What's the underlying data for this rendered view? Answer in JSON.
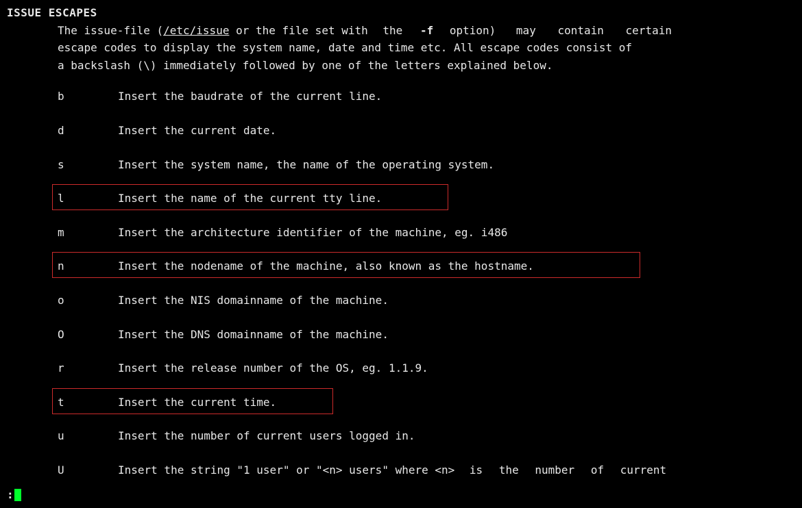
{
  "section_title": "ISSUE ESCAPES",
  "intro_pre": "The issue-file (",
  "intro_path": "/etc/issue",
  "intro_post1": " or the file set with",
  "intro_the1": "the",
  "intro_flag": "-f",
  "intro_opt": "option)",
  "intro_may": "may",
  "intro_contain": "contain",
  "intro_certain": "certain",
  "intro_line2": "escape  codes to display the system name, date and time etc. All escape codes consist of",
  "intro_line3": "a backslash (\\) immediately followed by one of the letters explained below.",
  "entries": [
    {
      "key": "b",
      "text": "Insert the baudrate of the current line."
    },
    {
      "key": "d",
      "text": "Insert the current date."
    },
    {
      "key": "s",
      "text": "Insert the system name, the name of the operating system."
    },
    {
      "key": "l",
      "text": "Insert the name of the current tty line."
    },
    {
      "key": "m",
      "text": "Insert the architecture identifier of the machine, eg. i486"
    },
    {
      "key": "n",
      "text": "Insert the nodename of the machine, also known as the hostname."
    },
    {
      "key": "o",
      "text": "Insert the NIS domainname of the machine."
    },
    {
      "key": "O",
      "text": "Insert the DNS domainname of the machine."
    },
    {
      "key": "r",
      "text": "Insert the release number of the OS, eg. 1.1.9."
    },
    {
      "key": "t",
      "text": "Insert the current time."
    },
    {
      "key": "u",
      "text": "Insert the number of current users logged in."
    }
  ],
  "U_key": "U",
  "U_pre": "Insert the string \"1 user\" or \"<n> users\" where <n>",
  "U_w1": "is",
  "U_w2": "the",
  "U_w3": "number",
  "U_w4": "of",
  "U_w5": "current",
  "prompt": ":"
}
